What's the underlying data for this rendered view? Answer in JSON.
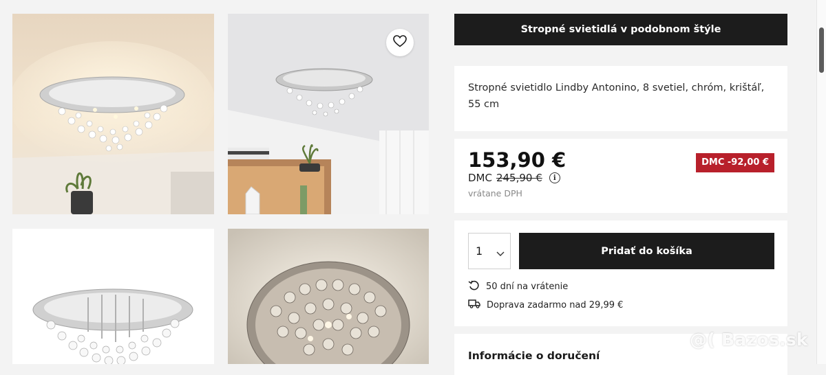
{
  "gallery": {
    "images": [
      {
        "name": "product-photo-1",
        "alt": "chandelier ceiling warm room"
      },
      {
        "name": "product-photo-2",
        "alt": "chandelier in room with shelf"
      },
      {
        "name": "product-photo-3",
        "alt": "chandelier white background"
      },
      {
        "name": "product-photo-4",
        "alt": "chandelier close-up from below"
      }
    ],
    "wishlist_icon": "heart-icon"
  },
  "similar": {
    "label": "Stropné svietidlá v podobnom štýle"
  },
  "product": {
    "title": "Stropné svietidlo Lindby Antonino, 8 svetiel, chróm, krištáľ, 55 cm"
  },
  "pricing": {
    "price": "153,90 €",
    "dmc_label": "DMC",
    "old_price": "245,90 €",
    "vat_note": "vrátane DPH",
    "discount_badge": "DMC -92,00 €",
    "badge_color": "#b8202b"
  },
  "cart": {
    "quantity": "1",
    "add_label": "Pridať do košíka",
    "features": [
      {
        "icon": "return-arrow-icon",
        "text": "50 dní na vrátenie"
      },
      {
        "icon": "truck-icon",
        "text": "Doprava zadarmo nad 29,99 €"
      }
    ]
  },
  "delivery": {
    "title": "Informácie o doručení"
  },
  "watermark": {
    "text": "@( Bazos.sk"
  }
}
